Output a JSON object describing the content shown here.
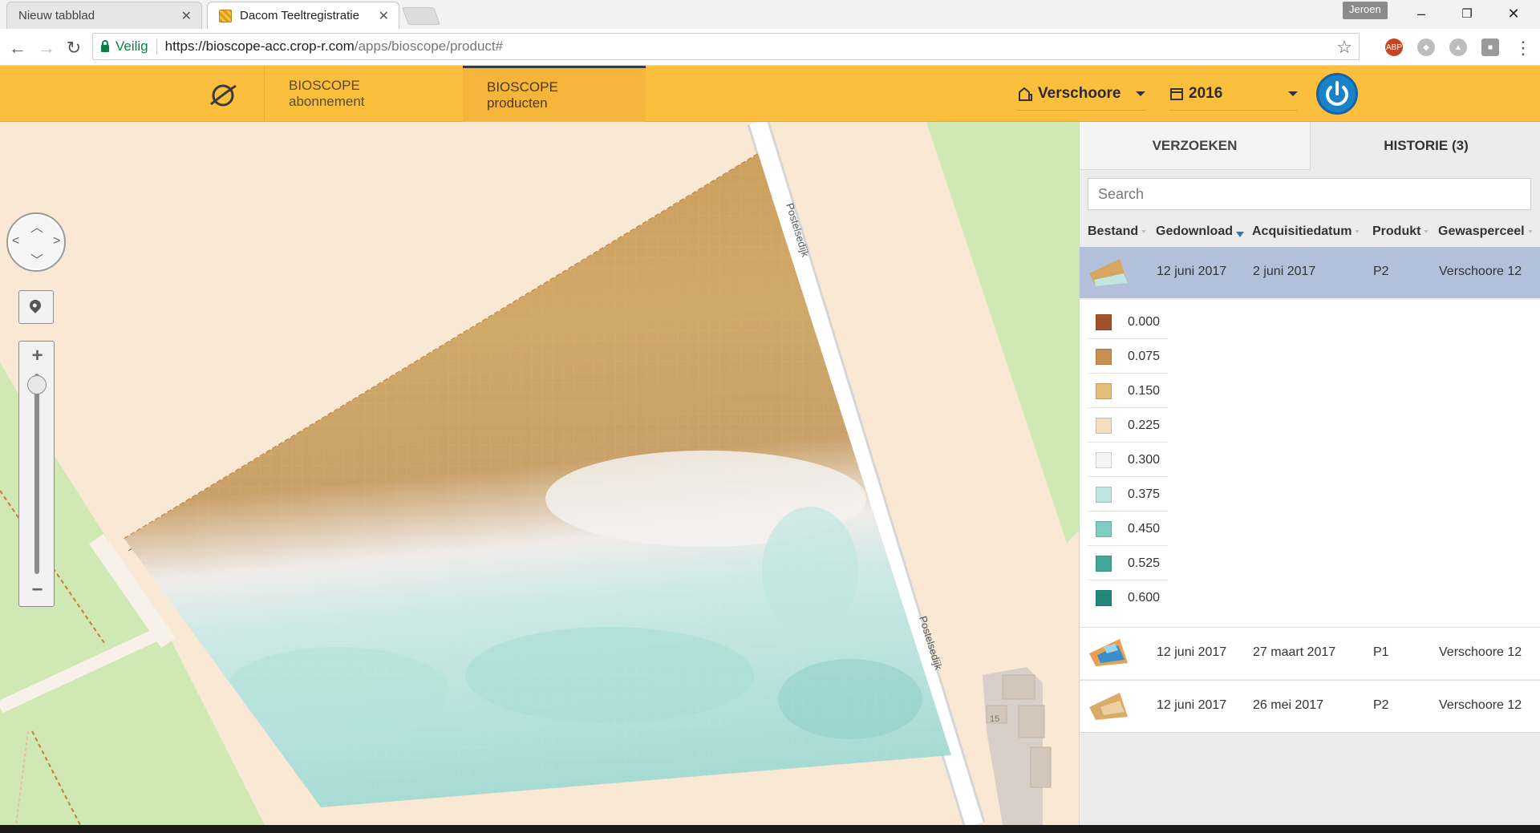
{
  "browser": {
    "tabs": [
      {
        "label": "Nieuw tabblad",
        "active": false
      },
      {
        "label": "Dacom Teeltregistratie",
        "active": true
      }
    ],
    "profile": "Jeroen",
    "security_label": "Veilig",
    "url_host": "https://bioscope-acc.crop-r.com",
    "url_path": "/apps/bioscope/product#",
    "extensions": [
      "ABP",
      "dropbox-icon",
      "drive-icon",
      "extension-icon"
    ]
  },
  "app": {
    "nav": [
      {
        "label": "BIOSCOPE abonnement",
        "active": false
      },
      {
        "label": "BIOSCOPE producten",
        "active": true
      }
    ],
    "farm_dropdown": "Verschoore",
    "year_dropdown": "2016"
  },
  "map": {
    "road_labels": [
      "Postelsedijk",
      "Postelsedijk"
    ],
    "house_number": "15"
  },
  "panel": {
    "tabs": [
      "VERZOEKEN",
      "HISTORIE (3)"
    ],
    "active_tab": "HISTORIE (3)",
    "search_placeholder": "Search",
    "columns": [
      "Bestand",
      "Gedownload",
      "Acquisitiedatum",
      "Produkt",
      "Gewasperceel"
    ],
    "sorted_column": "Gedownload",
    "rows": [
      {
        "gedownload": "12 juni 2017",
        "acquisitiedatum": "2 juni 2017",
        "produkt": "P2",
        "gewasperceel": "Verschoore 12",
        "selected": true
      },
      {
        "gedownload": "12 juni 2017",
        "acquisitiedatum": "27 maart 2017",
        "produkt": "P1",
        "gewasperceel": "Verschoore 12",
        "selected": false
      },
      {
        "gedownload": "12 juni 2017",
        "acquisitiedatum": "26 mei 2017",
        "produkt": "P2",
        "gewasperceel": "Verschoore 12",
        "selected": false
      }
    ],
    "legend": [
      {
        "value": "0.000",
        "color": "#a0522d"
      },
      {
        "value": "0.075",
        "color": "#c89050"
      },
      {
        "value": "0.150",
        "color": "#e3be7a"
      },
      {
        "value": "0.225",
        "color": "#f1dfc0"
      },
      {
        "value": "0.300",
        "color": "#f4f4f4"
      },
      {
        "value": "0.375",
        "color": "#bde4e0"
      },
      {
        "value": "0.450",
        "color": "#7fccc4"
      },
      {
        "value": "0.525",
        "color": "#3fa996"
      },
      {
        "value": "0.600",
        "color": "#22897a"
      }
    ]
  },
  "colors": {
    "brand_yellow": "#fbbf3d",
    "selected_row": "#b2c0db",
    "power_blue": "#1a82c7"
  }
}
